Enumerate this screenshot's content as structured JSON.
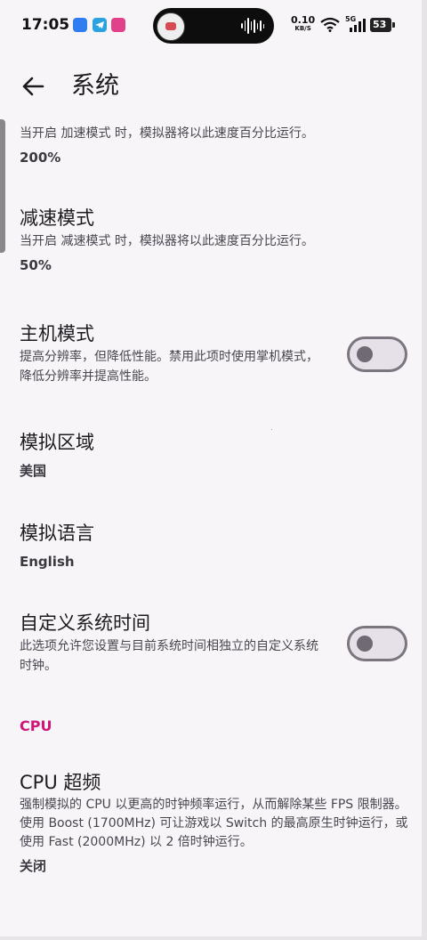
{
  "status_bar": {
    "time": "17:05",
    "net_speed": "0.10",
    "net_unit": "KB/S",
    "network_type": "5G",
    "battery_level": "53",
    "icons": [
      "app-notification-icon",
      "telegram-icon",
      "app-icon",
      "audio-wave-icon",
      "wifi-icon",
      "signal-icon",
      "battery-icon"
    ]
  },
  "app_bar": {
    "title": "系统",
    "back_icon": "arrow-back-icon"
  },
  "settings": [
    {
      "id": "turbo",
      "title": "",
      "description": "当开启 加速模式 时，模拟器将以此速度百分比运行。",
      "value": "200%"
    },
    {
      "id": "slow",
      "title": "减速模式",
      "description": "当开启 减速模式 时，模拟器将以此速度百分比运行。",
      "value": "50%"
    },
    {
      "id": "docked",
      "title": "主机模式",
      "description": "提高分辨率，但降低性能。禁用此项时使用掌机模式，降低分辨率并提高性能。",
      "toggle": false
    },
    {
      "id": "region",
      "title": "模拟区域",
      "value": "美国"
    },
    {
      "id": "language",
      "title": "模拟语言",
      "value": "English"
    },
    {
      "id": "custom_rtc",
      "title": "自定义系统时间",
      "description": "此选项允许您设置与目前系统时间相独立的自定义系统时钟。",
      "toggle": false
    },
    {
      "id": "cpu_overclock",
      "title": "CPU 超频",
      "description": "强制模拟的 CPU 以更高的时钟频率运行，从而解除某些 FPS 限制器。使用 Boost (1700MHz) 可让游戏以 Switch 的最高原生时钟运行，或使用 Fast (2000MHz) 以 2 倍时钟运行。",
      "value": "关闭"
    }
  ],
  "sections": {
    "cpu": "CPU"
  },
  "colors": {
    "background": "#f8f5f8",
    "accent": "#d0157a",
    "toggle_off_track": "#e6e0e9",
    "toggle_off_border": "#7a757f"
  }
}
